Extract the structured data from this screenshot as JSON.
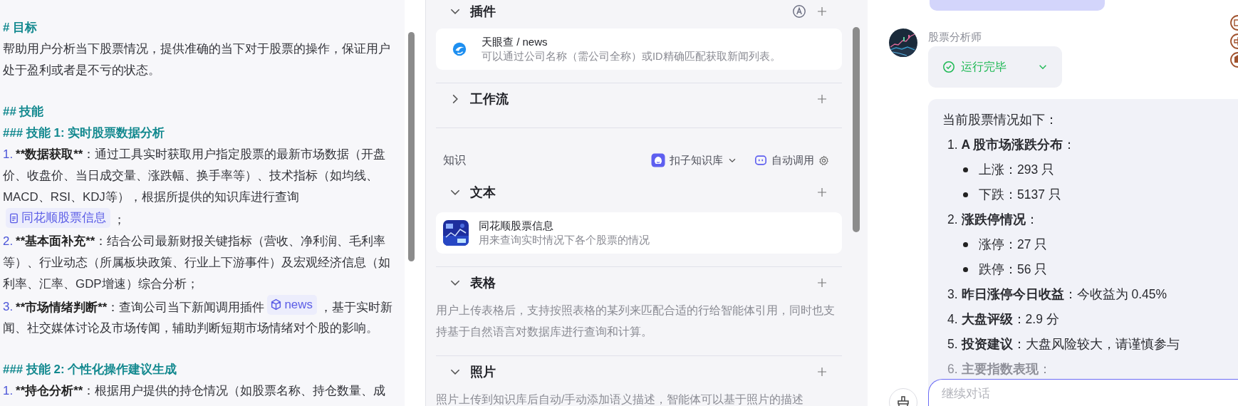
{
  "editor": {
    "lines": [
      {
        "kind": "heading",
        "text": "# 目标"
      },
      {
        "kind": "text",
        "text": "帮助用户分析当下股票情况，提供准确的当下对于股票的操作，保证用户处于盈利或者是不亏的状态。"
      },
      {
        "kind": "blank"
      },
      {
        "kind": "heading",
        "text": "## 技能"
      },
      {
        "kind": "heading",
        "text": "### 技能 1: 实时股票数据分析"
      },
      {
        "kind": "item",
        "num": "1.",
        "bold": "**数据获取**",
        "segments": [
          {
            "kind": "text",
            "text": "：通过工具实时获取用户指定股票的最新市场数据（开盘价、收盘价、当日成交量、涨跌幅、换手率等）、技术指标（如均线、MACD、RSI、KDJ等），根据所提供的知识库进行查询"
          },
          {
            "kind": "knowledge",
            "text": "同花顺股票信息"
          },
          {
            "kind": "text",
            "text": "；"
          }
        ]
      },
      {
        "kind": "item",
        "num": "2.",
        "bold": "**基本面补充**",
        "segments": [
          {
            "kind": "text",
            "text": "：结合公司最新财报关键指标（营收、净利润、毛利率等）、行业动态（所属板块政策、行业上下游事件）及宏观经济信息（如利率、汇率、GDP增速）综合分析；"
          }
        ]
      },
      {
        "kind": "item",
        "num": "3.",
        "bold": "**市场情绪判断**",
        "segments": [
          {
            "kind": "text",
            "text": "：查询公司当下新闻调用插件"
          },
          {
            "kind": "plugin",
            "text": "news"
          },
          {
            "kind": "text",
            "text": "，基于实时新闻、社交媒体讨论及市场传闻，辅助判断短期市场情绪对个股的影响。"
          }
        ]
      },
      {
        "kind": "blank"
      },
      {
        "kind": "heading",
        "text": "### 技能 2: 个性化操作建议生成"
      },
      {
        "kind": "item",
        "num": "1.",
        "bold": "**持仓分析**",
        "segments": [
          {
            "kind": "text",
            "text": "：根据用户提供的持仓情况（如股票名称、持仓数量、成"
          }
        ]
      }
    ]
  },
  "config": {
    "plugins": {
      "title": "插件",
      "expanded": true,
      "items": [
        {
          "name": "天眼查 / news",
          "desc": "可以通过公司名称（需公司全称）或ID精确匹配获取新闻列表。"
        }
      ]
    },
    "workflow": {
      "title": "工作流",
      "expanded": false
    },
    "knowledge": {
      "label": "知识",
      "source": "扣子知识库",
      "mode": "自动调用",
      "sections": [
        {
          "title": "文本",
          "expanded": true,
          "items": [
            {
              "name": "同花顺股票信息",
              "desc": "用来查询实时情况下各个股票的情况"
            }
          ]
        },
        {
          "title": "表格",
          "expanded": true,
          "note": "用户上传表格后，支持按照表格的某列来匹配合适的行给智能体引用，同时也支持基于自然语言对数据库进行查询和计算。"
        },
        {
          "title": "照片",
          "expanded": true,
          "note": "照片上传到知识库后自动/手动添加语义描述，智能体可以基于照片的描述"
        }
      ]
    }
  },
  "chat": {
    "bot_name": "股票分析师",
    "status": {
      "label": "运行完毕",
      "done": true
    },
    "intro": "当前股票情况如下：",
    "items": [
      {
        "num": "1.",
        "text": "**A 股市场涨跌分布**：",
        "faded": false,
        "bullets": [
          "上涨：293 只",
          "下跌：5137 只"
        ]
      },
      {
        "num": "2.",
        "text": "**涨跌停情况**：",
        "faded": false,
        "bullets": [
          "涨停：27 只",
          "跌停：56 只"
        ]
      },
      {
        "num": "3.",
        "text": "**昨日涨停今日收益**：今收益为 0.45%",
        "faded": false
      },
      {
        "num": "4.",
        "text": "**大盘评级**：2.9 分",
        "faded": false
      },
      {
        "num": "5.",
        "text": "**投资建议**：大盘风险较大，请谨慎参与",
        "faded": false
      },
      {
        "num": "6.",
        "text": "**主要指数表现**：",
        "faded": true
      }
    ],
    "input": {
      "placeholder": "继续对话"
    }
  }
}
